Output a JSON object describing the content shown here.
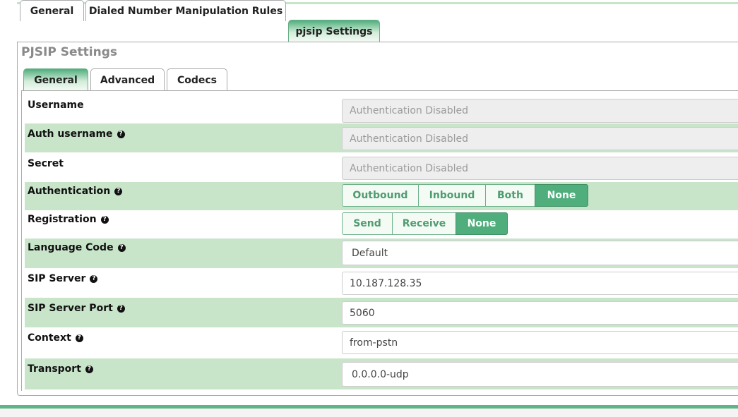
{
  "outer_tabs": [
    {
      "label": "General"
    },
    {
      "label": "Dialed Number Manipulation Rules"
    },
    {
      "label": "pjsip Settings"
    }
  ],
  "section_title": "PJSIP Settings",
  "inner_tabs": [
    {
      "label": "General"
    },
    {
      "label": "Advanced"
    },
    {
      "label": "Codecs"
    }
  ],
  "fields": {
    "username": {
      "label": "Username",
      "value": "Authentication Disabled"
    },
    "auth_username": {
      "label": "Auth username",
      "value": "Authentication Disabled"
    },
    "secret": {
      "label": "Secret",
      "value": "Authentication Disabled"
    },
    "authentication": {
      "label": "Authentication",
      "options": [
        "Outbound",
        "Inbound",
        "Both",
        "None"
      ],
      "selected": "None"
    },
    "registration": {
      "label": "Registration",
      "options": [
        "Send",
        "Receive",
        "None"
      ],
      "selected": "None"
    },
    "language_code": {
      "label": "Language Code",
      "value": "Default"
    },
    "sip_server": {
      "label": "SIP Server",
      "value": "10.187.128.35"
    },
    "sip_server_port": {
      "label": "SIP Server Port",
      "value": "5060"
    },
    "context": {
      "label": "Context",
      "value": "from-pstn"
    },
    "transport": {
      "label": "Transport",
      "value": "0.0.0.0-udp"
    }
  },
  "help_glyph": "?",
  "colors": {
    "accent": "#4fae7c",
    "row_shade": "#c8e5ca",
    "disabled_bg": "#eeeeee"
  }
}
